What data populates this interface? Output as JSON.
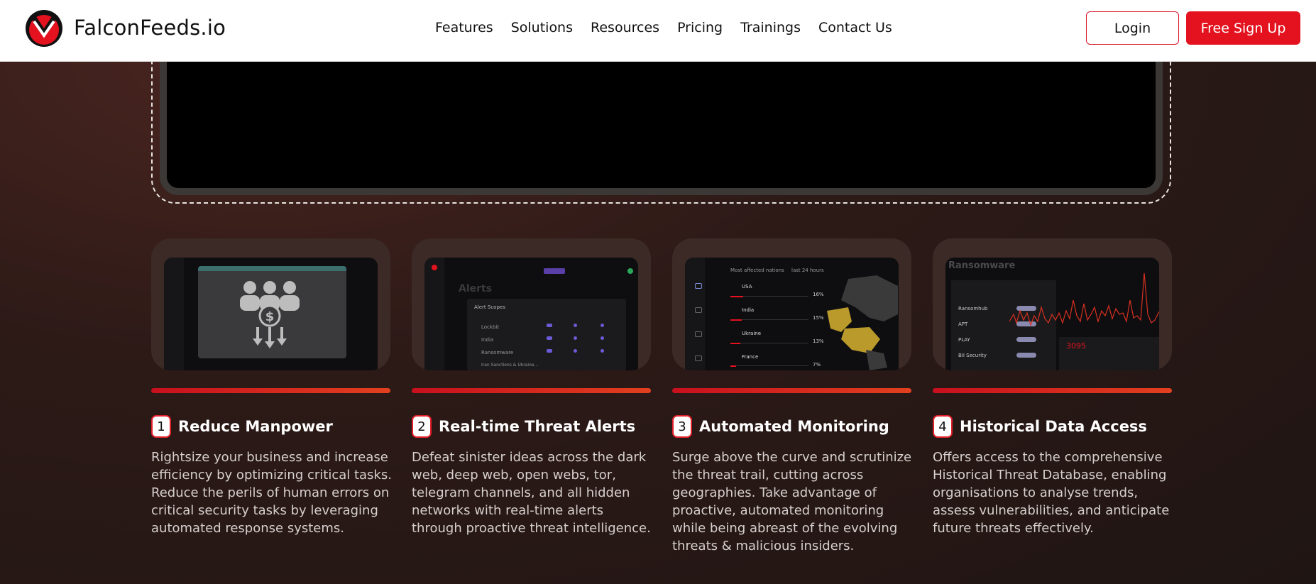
{
  "header": {
    "brand": "FalconFeeds.io",
    "nav": [
      "Features",
      "Solutions",
      "Resources",
      "Pricing",
      "Trainings",
      "Contact Us"
    ],
    "login_label": "Login",
    "signup_label": "Free Sign Up"
  },
  "colors": {
    "accent": "#e3121e",
    "background": "#2d1a17",
    "card_bar_start": "#c8101e",
    "card_bar_end": "#e2401f"
  },
  "cards": [
    {
      "number": "1",
      "title": "Reduce Manpower",
      "description": "Rightsize your business and increase efficiency by optimizing critical tasks. Reduce the perils of human errors on critical security tasks by leveraging automated response systems.",
      "icon": "people-dollar-icon"
    },
    {
      "number": "2",
      "title": "Real-time Threat Alerts",
      "description": "Defeat sinister ideas across the dark web, deep web, open webs, tor, telegram channels, and all hidden networks with real-time alerts through proactive threat intelligence.",
      "thumb_heading": "Alerts",
      "thumb_subheading": "Alert Scopes",
      "thumb_rows": [
        "Lockbit",
        "India",
        "Ransomware",
        "Iran Sanctions & Ukraine..."
      ]
    },
    {
      "number": "3",
      "title": "Automated Monitoring",
      "description": "Surge above the curve and scrutinize the threat trail, cutting across geographies. Take advantage of proactive, automated monitoring while being abreast of the evolving threats & malicious insiders.",
      "thumb_heading": "Most affected nations",
      "thumb_filter": "last 24 hours",
      "thumb_nations": [
        {
          "name": "USA",
          "pct": "16%",
          "value": 0.16
        },
        {
          "name": "India",
          "pct": "15%",
          "value": 0.15
        },
        {
          "name": "Ukraine",
          "pct": "13%",
          "value": 0.13
        },
        {
          "name": "France",
          "pct": "7%",
          "value": 0.07
        }
      ]
    },
    {
      "number": "4",
      "title": "Historical Data Access",
      "description": "Offers access to the comprehensive Historical Threat Database, enabling organisations to analyse trends, assess vulnerabilities, and anticipate future threats effectively.",
      "thumb_heading": "Ransomware",
      "thumb_actors": [
        "Ransomhub",
        "APT",
        "PLAY",
        "BII Security"
      ],
      "thumb_stat": "3095"
    }
  ]
}
